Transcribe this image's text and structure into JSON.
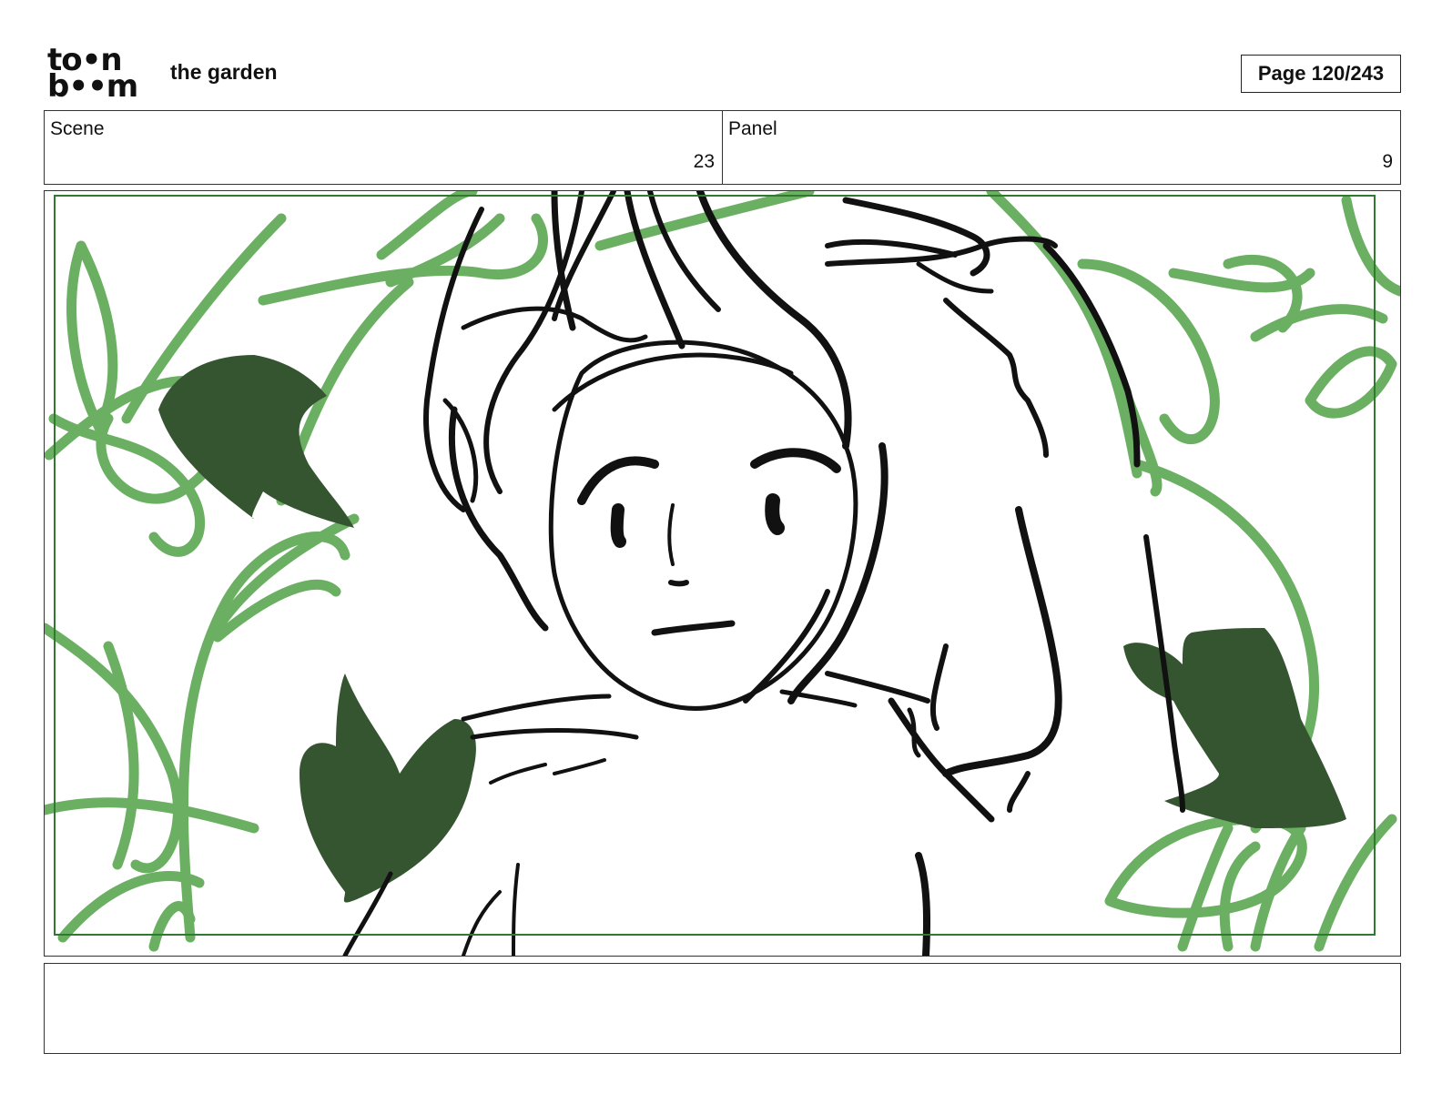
{
  "header": {
    "logo_line1": "to•n",
    "logo_line2": "b••m",
    "project_title": "the garden",
    "page_label": "Page 120/243"
  },
  "info": {
    "scene_label": "Scene",
    "scene_value": "23",
    "panel_label": "Panel",
    "panel_value": "9"
  },
  "caption": {
    "text": ""
  },
  "colors": {
    "vine_green": "#6aaf62",
    "leaf_dark": "#355531",
    "safe_frame": "#2f7a2f",
    "ink": "#111111"
  }
}
